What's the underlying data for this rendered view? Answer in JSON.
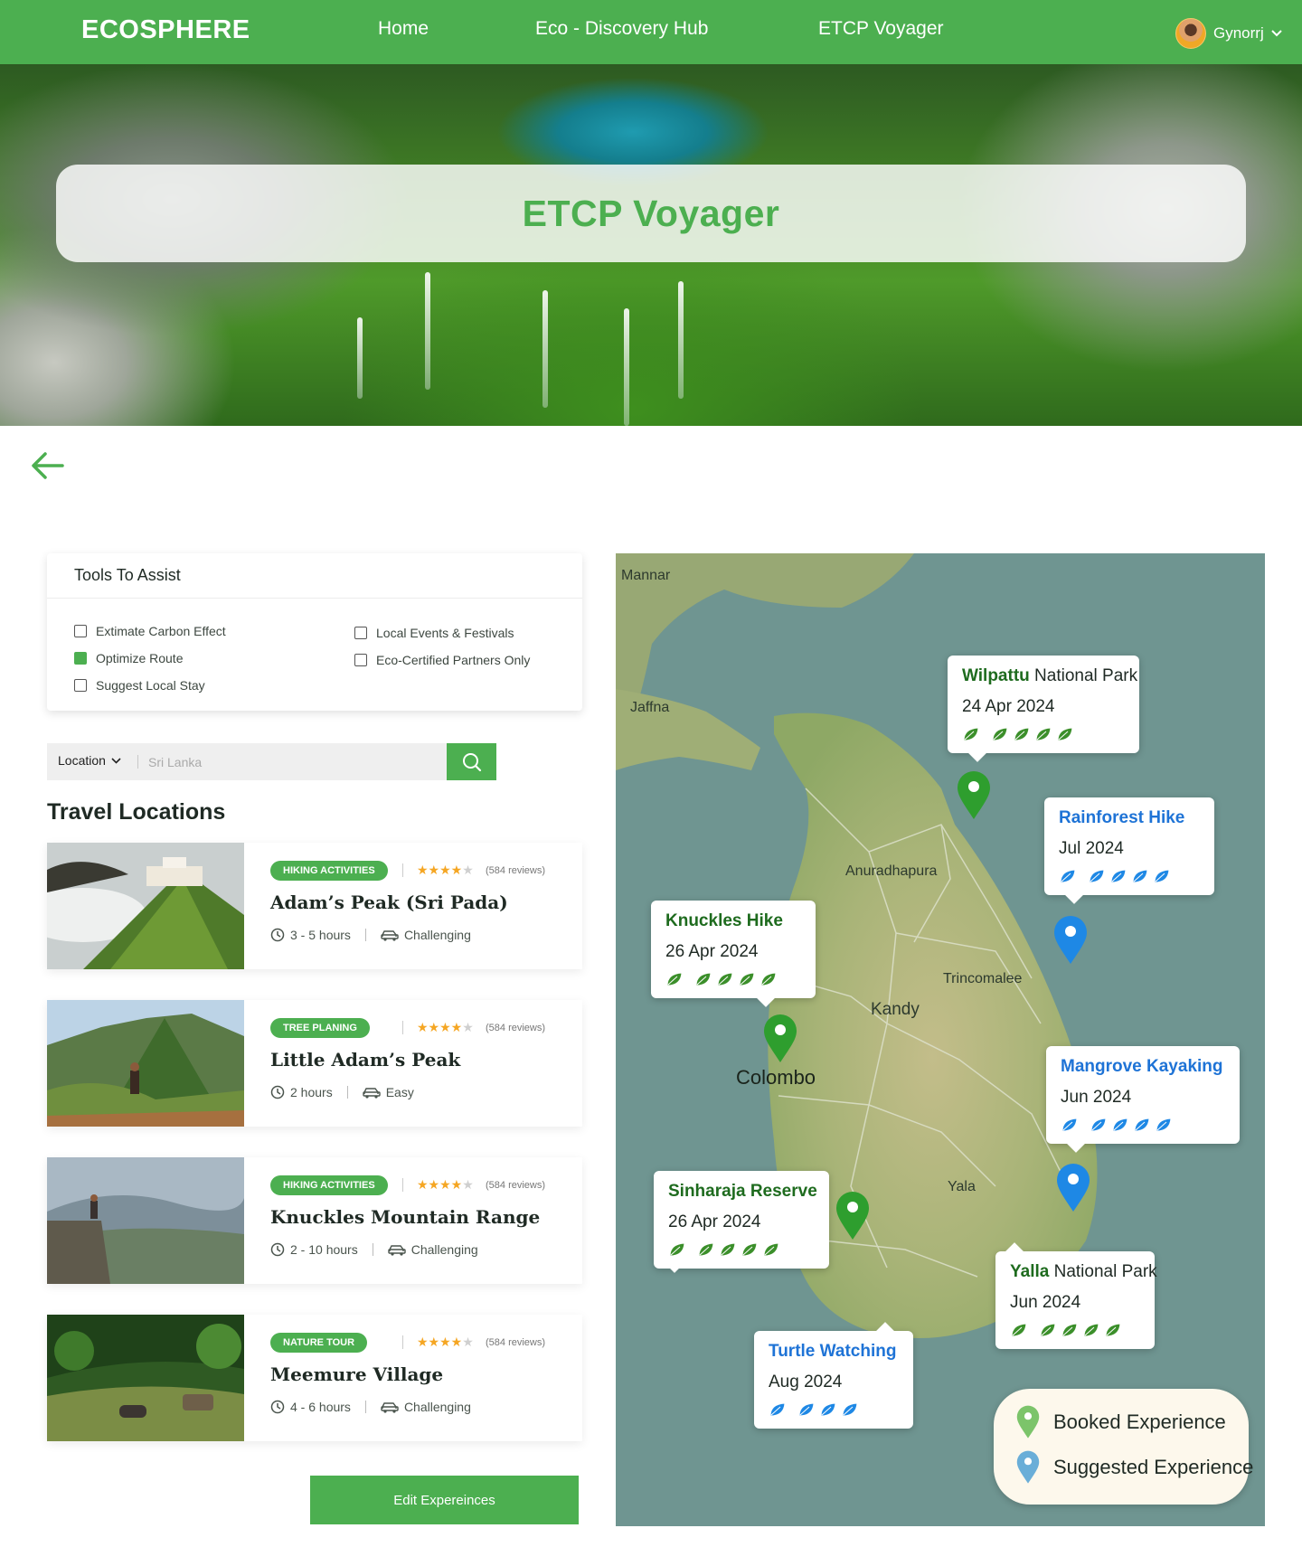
{
  "nav": {
    "brand": "ECOSPHERE",
    "links": [
      "Home",
      "Eco - Discovery Hub",
      "ETCP Voyager"
    ],
    "user": "Gynorrj"
  },
  "hero": {
    "title": "ETCP Voyager"
  },
  "tools": {
    "title": "Tools To Assist",
    "options": [
      {
        "label": "Extimate Carbon Effect",
        "checked": false
      },
      {
        "label": "Optimize Route",
        "checked": true
      },
      {
        "label": "Suggest Local Stay",
        "checked": false
      },
      {
        "label": "Local Events & Festivals",
        "checked": false
      },
      {
        "label": "Eco-Certified Partners Only",
        "checked": false
      }
    ]
  },
  "search": {
    "filter_label": "Location",
    "placeholder": "Sri Lanka",
    "value": ""
  },
  "travel": {
    "title": "Travel Locations",
    "locations": [
      {
        "tag": "HIKING ACTIVITIES",
        "rating": 4,
        "reviews": "(584 reviews)",
        "name": "Adam’s Peak (Sri Pada)",
        "duration": "3 - 5 hours",
        "difficulty": "Challenging"
      },
      {
        "tag": "TREE PLANING",
        "rating": 4,
        "reviews": "(584 reviews)",
        "name": "Little Adam’s Peak",
        "duration": "2 hours",
        "difficulty": "Easy"
      },
      {
        "tag": "HIKING ACTIVITIES",
        "rating": 4,
        "reviews": "(584 reviews)",
        "name": "Knuckles Mountain Range",
        "duration": "2 - 10 hours",
        "difficulty": "Challenging"
      },
      {
        "tag": "NATURE TOUR",
        "rating": 4,
        "reviews": "(584 reviews)",
        "name": "Meemure Village",
        "duration": "4 - 6 hours",
        "difficulty": "Challenging"
      }
    ]
  },
  "edit_button": "Edit Expereinces",
  "map": {
    "cities": [
      "Mannar",
      "Jaffna",
      "Anuradhapura",
      "Trincomalee",
      "Kandy",
      "Colombo",
      "Yala"
    ],
    "popups": [
      {
        "title_main": "Wilpattu",
        "title_rest": " National Park",
        "date": "24 Apr 2024",
        "leaves": 4,
        "kind": "booked"
      },
      {
        "title_main": "Rainforest Hike",
        "title_rest": "",
        "date": "Jul 2024",
        "leaves": 4,
        "kind": "suggested"
      },
      {
        "title_main": "Knuckles Hike",
        "title_rest": "",
        "date": "26 Apr 2024",
        "leaves": 4,
        "kind": "booked"
      },
      {
        "title_main": "Mangrove Kayaking",
        "title_rest": "",
        "date": "Jun 2024",
        "leaves": 4,
        "kind": "suggested"
      },
      {
        "title_main": "Sinharaja Reserve",
        "title_rest": "",
        "date": "26 Apr 2024",
        "leaves": 4,
        "kind": "booked"
      },
      {
        "title_main": "Yalla",
        "title_rest": " National Park",
        "date": "Jun 2024",
        "leaves": 4,
        "kind": "booked"
      },
      {
        "title_main": "Turtle Watching",
        "title_rest": "",
        "date": "Aug 2024",
        "leaves": 3,
        "kind": "suggested"
      }
    ],
    "legend": {
      "booked": "Booked Experience",
      "suggested": "Suggested Experience"
    }
  },
  "colors": {
    "brand": "#4caf50",
    "booked_pin": "#2e9e2e",
    "suggested_pin": "#1e88e5",
    "star": "#f5a623"
  }
}
